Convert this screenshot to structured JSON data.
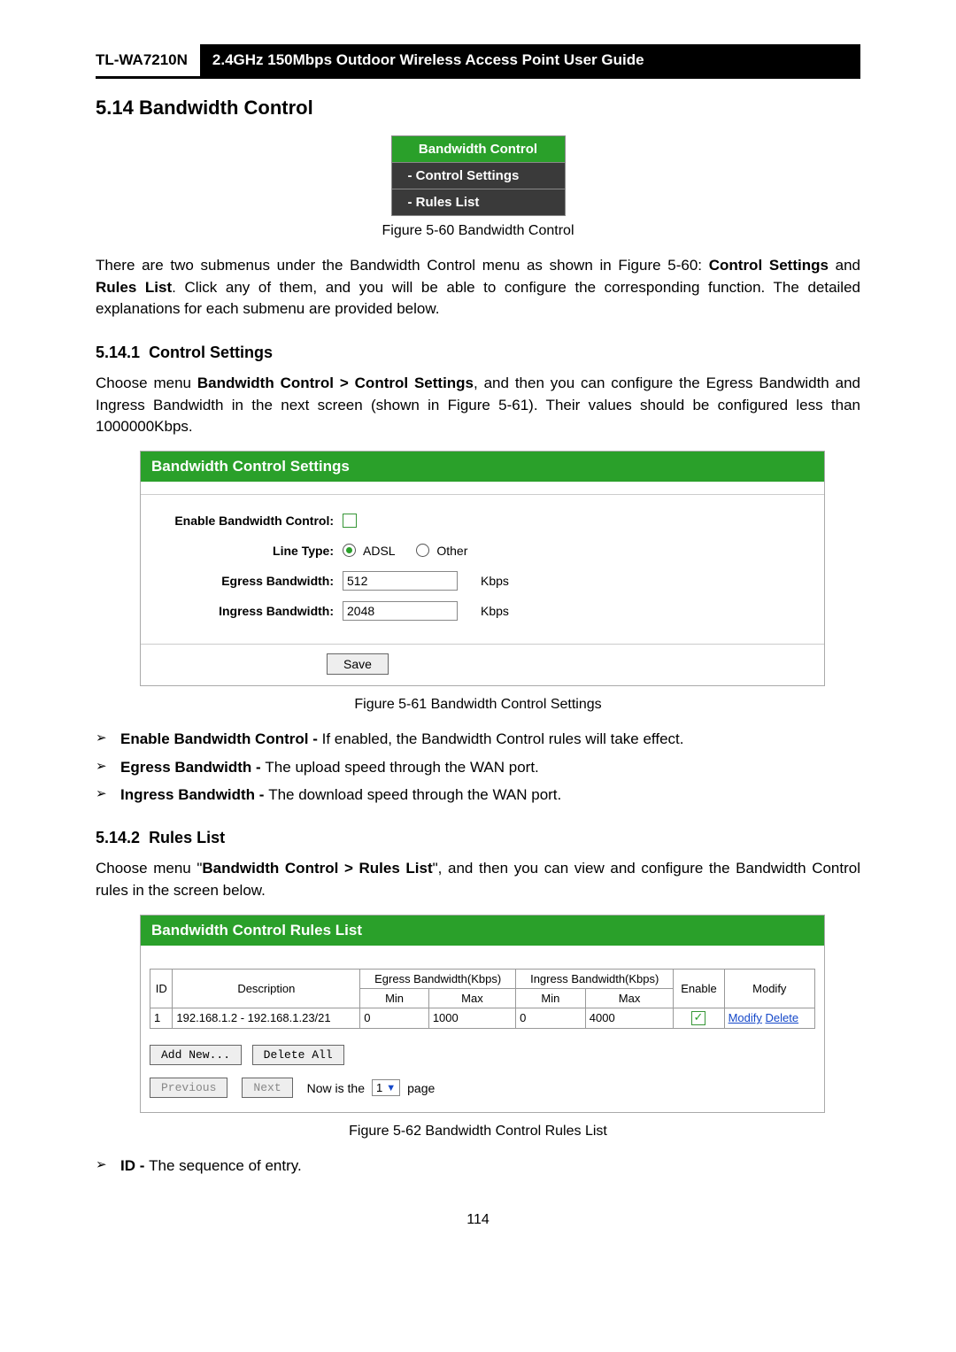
{
  "header": {
    "model": "TL-WA7210N",
    "title": "2.4GHz 150Mbps Outdoor Wireless Access Point User Guide"
  },
  "section": {
    "number": "5.14",
    "title": "Bandwidth Control"
  },
  "menu": {
    "head": "Bandwidth Control",
    "items": [
      "- Control Settings",
      "- Rules List"
    ]
  },
  "figure60_caption": "Figure 5-60 Bandwidth Control",
  "intro_p1_a": "There are two submenus under the Bandwidth Control menu as shown in Figure 5-60: ",
  "intro_p1_b": "Control Settings",
  "intro_p1_c": " and ",
  "intro_p1_d": "Rules List",
  "intro_p1_e": ". Click any of them, and you will be able to configure the corresponding function. The detailed explanations for each submenu are provided below.",
  "sub1": {
    "number": "5.14.1",
    "title": "Control Settings",
    "p1_a": "Choose menu ",
    "p1_b": "Bandwidth Control > Control Settings",
    "p1_c": ", and then you can configure the Egress Bandwidth and Ingress Bandwidth in the next screen (shown in Figure 5-61). Their values should be configured less than 1000000Kbps."
  },
  "settings_panel": {
    "title": "Bandwidth Control Settings",
    "labels": {
      "enable": "Enable Bandwidth Control:",
      "line_type": "Line Type:",
      "egress": "Egress Bandwidth:",
      "ingress": "Ingress Bandwidth:"
    },
    "line_opts": {
      "adsl": "ADSL",
      "other": "Other"
    },
    "egress_value": "512",
    "ingress_value": "2048",
    "unit": "Kbps",
    "save": "Save"
  },
  "figure61_caption": "Figure 5-61 Bandwidth Control Settings",
  "bullets1": [
    {
      "b": "Enable Bandwidth Control - ",
      "t": "If enabled, the Bandwidth Control rules will take effect."
    },
    {
      "b": "Egress Bandwidth - ",
      "t": "The upload speed through the WAN port."
    },
    {
      "b": "Ingress Bandwidth - ",
      "t": "The download speed through the WAN port."
    }
  ],
  "sub2": {
    "number": "5.14.2",
    "title": "Rules List",
    "p1_a": "Choose menu \"",
    "p1_b": "Bandwidth Control > Rules List",
    "p1_c": "\", and then you can view and configure the Bandwidth Control rules in the screen below."
  },
  "rules_panel": {
    "title": "Bandwidth Control Rules List",
    "headers": {
      "id": "ID",
      "desc": "Description",
      "egress": "Egress Bandwidth(Kbps)",
      "ingress": "Ingress Bandwidth(Kbps)",
      "min": "Min",
      "max": "Max",
      "enable": "Enable",
      "modify": "Modify"
    },
    "row": {
      "id": "1",
      "desc": "192.168.1.2 - 192.168.1.23/21",
      "emin": "0",
      "emax": "1000",
      "imin": "0",
      "imax": "4000",
      "modify": "Modify",
      "delete": "Delete"
    },
    "buttons": {
      "add": "Add New...",
      "delall": "Delete All",
      "prev": "Previous",
      "next": "Next"
    },
    "pager": {
      "prefix": "Now is the",
      "value": "1",
      "suffix": "page"
    }
  },
  "figure62_caption": "Figure 5-62 Bandwidth Control Rules List",
  "bullets2": [
    {
      "b": "ID - ",
      "t": "The sequence of entry."
    }
  ],
  "pagenum": "114"
}
